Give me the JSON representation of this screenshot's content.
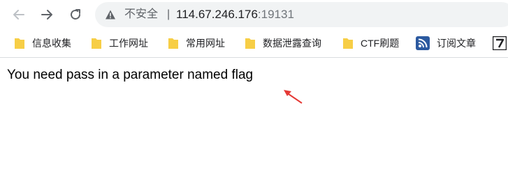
{
  "browser": {
    "security_label": "不安全",
    "separator": "|",
    "url_host": "114.67.246.176",
    "url_port": ":19131"
  },
  "bookmarks": [
    {
      "label": "信息收集",
      "icon": "folder-icon"
    },
    {
      "label": "工作网址",
      "icon": "folder-icon"
    },
    {
      "label": "常用网址",
      "icon": "folder-icon"
    },
    {
      "label": "数据泄露查询",
      "icon": "folder-icon"
    },
    {
      "label": "CTF刷题",
      "icon": "folder-icon"
    },
    {
      "label": "订阅文章",
      "icon": "rss-site-icon"
    },
    {
      "label": "",
      "icon": "site-favicon"
    }
  ],
  "page": {
    "message": "You need pass in a parameter named flag"
  },
  "annotation": {
    "arrow_color": "#e53935"
  },
  "colors": {
    "omnibox_bg": "#f1f3f4",
    "folder_yellow": "#f7ce46",
    "text": "#202124"
  }
}
